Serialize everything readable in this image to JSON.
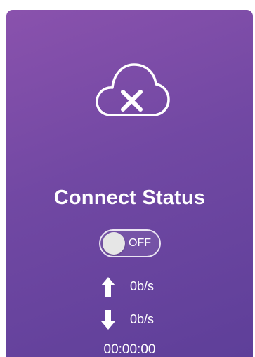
{
  "status_icon": "cloud-disconnected-icon",
  "title": "Connect Status",
  "toggle": {
    "label": "OFF",
    "state": "off"
  },
  "upload": {
    "icon": "arrow-up-icon",
    "rate": "0b/s"
  },
  "download": {
    "icon": "arrow-down-icon",
    "rate": "0b/s"
  },
  "timer": "00:00:00",
  "colors": {
    "panel_gradient_start": "#8a52ad",
    "panel_gradient_end": "#5e3f99",
    "text": "#ffffff",
    "knob": "#e6e6e6"
  }
}
